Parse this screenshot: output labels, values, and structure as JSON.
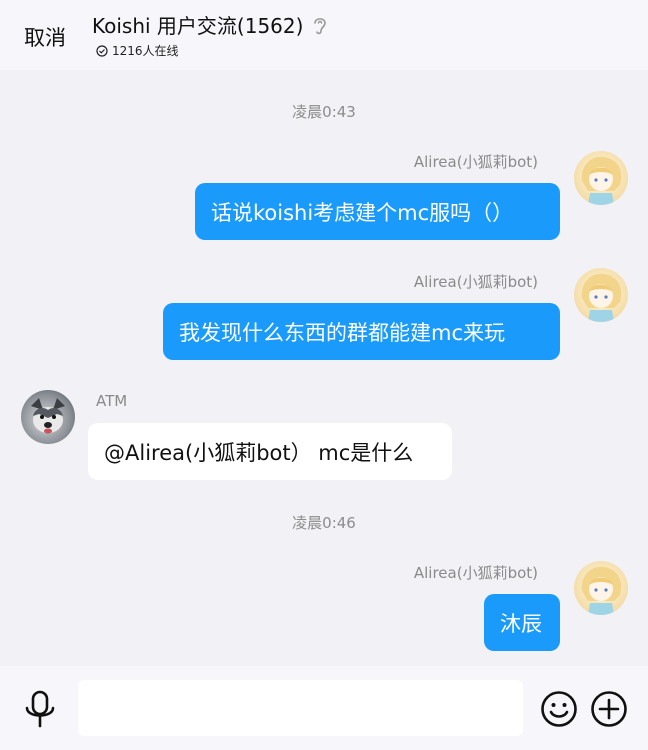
{
  "header": {
    "cancel_label": "取消",
    "title": "Koishi 用户交流(1562)",
    "online_text": "1216人在线"
  },
  "messages": [
    {
      "type": "time",
      "text": "凌晨0:43"
    },
    {
      "type": "out",
      "sender": "Alirea(小狐莉bot)",
      "text": "话说koishi考虑建个mc服吗（）"
    },
    {
      "type": "out",
      "sender": "Alirea(小狐莉bot)",
      "text": "我发现什么东西的群都能建mc来玩"
    },
    {
      "type": "in",
      "sender": "ATM",
      "text": "@Alirea(小狐莉bot） mc是什么"
    },
    {
      "type": "time",
      "text": "凌晨0:46"
    },
    {
      "type": "out",
      "sender": "Alirea(小狐莉bot)",
      "text": "沐辰"
    }
  ],
  "colors": {
    "accent": "#1a9bfb",
    "background": "#f2f1f6"
  },
  "icons": {
    "ear": "ear-icon",
    "online": "check-circle-icon",
    "mic": "mic-icon",
    "emoji": "emoji-icon",
    "plus": "plus-icon"
  }
}
